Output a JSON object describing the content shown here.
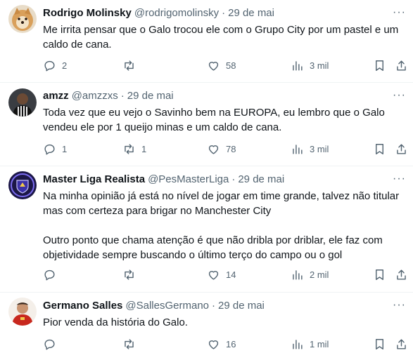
{
  "tweets": [
    {
      "name": "Rodrigo Molinsky",
      "handle": "@rodrigomolinsky",
      "date": "29 de mai",
      "text": [
        "Me irrita pensar que o Galo trocou ele com o Grupo City por um pastel e um caldo de cana."
      ],
      "replies": "2",
      "retweets": "",
      "likes": "58",
      "views": "3 mil",
      "avatar": "dog-avatar"
    },
    {
      "name": "amzz",
      "handle": "@amzzxs",
      "date": "29 de mai",
      "text": [
        "Toda vez que eu vejo o Savinho bem na EUROPA, eu lembro que o Galo vendeu ele por 1 queijo minas e um caldo de cana."
      ],
      "replies": "1",
      "retweets": "1",
      "likes": "78",
      "views": "3 mil",
      "avatar": "player-avatar"
    },
    {
      "name": "Master Liga Realista",
      "handle": "@PesMasterLiga",
      "date": "29 de mai",
      "text": [
        "Na minha opinião já está no nível de jogar em time grande, talvez não titular mas com certeza para brigar no Manchester City",
        "Outro ponto que chama atenção é que não dribla por driblar, ele faz com objetividade sempre buscando o último terço do campo ou o gol"
      ],
      "replies": "",
      "retweets": "",
      "likes": "14",
      "views": "2 mil",
      "avatar": "league-logo-avatar"
    },
    {
      "name": "Germano Salles",
      "handle": "@SallesGermano",
      "date": "29 de mai",
      "text": [
        "Pior venda da história do Galo."
      ],
      "replies": "",
      "retweets": "",
      "likes": "16",
      "views": "1 mil",
      "avatar": "red-shirt-avatar"
    }
  ],
  "colors": {
    "text": "#0f1419",
    "secondary": "#536471",
    "divider": "#eff3f4"
  }
}
